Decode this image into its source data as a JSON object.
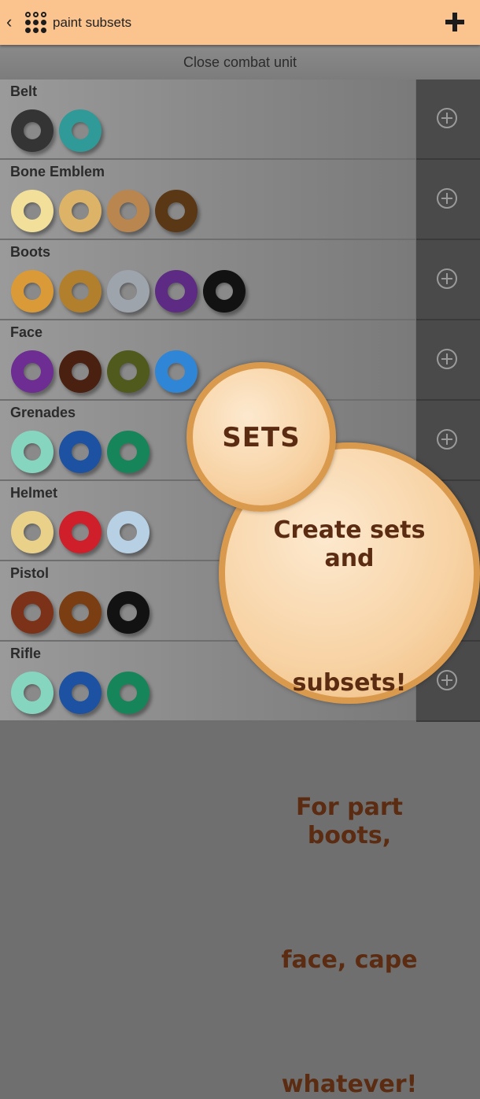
{
  "app": {
    "title": "paint subsets",
    "back_icon": "chevron-left-icon",
    "logo_icon": "dots-logo-icon",
    "add_icon": "plus-icon"
  },
  "set_name": "Close combat unit",
  "groups": [
    {
      "name": "Belt",
      "colors": [
        "#343434",
        "#2f9a97"
      ]
    },
    {
      "name": "Bone Emblem",
      "colors": [
        "#f1df9a",
        "#dcb367",
        "#b98650",
        "#5a3816"
      ]
    },
    {
      "name": "Boots",
      "colors": [
        "#d99a37",
        "#b27f2c",
        "#9da4ac",
        "#5d2b84",
        "#121212"
      ]
    },
    {
      "name": "Face",
      "colors": [
        "#6d2d92",
        "#4a2010",
        "#4f5a1c",
        "#2f86d6"
      ]
    },
    {
      "name": "Grenades",
      "colors": [
        "#86d6bf",
        "#1d52a3",
        "#17855a"
      ]
    },
    {
      "name": "Helmet",
      "colors": [
        "#ead18a",
        "#cf1f2a",
        "#b7d0e4"
      ]
    },
    {
      "name": "Pistol",
      "colors": [
        "#7b3219",
        "#7a3e12",
        "#121212"
      ]
    },
    {
      "name": "Rifle",
      "colors": [
        "#86d6bf",
        "#1d52a3",
        "#17855a"
      ]
    }
  ],
  "promo": {
    "badge": "SETS",
    "line1": "Create sets and",
    "line2": "subsets!",
    "line3": "For part boots,",
    "line4": "face, cape",
    "line5": "whatever!"
  }
}
